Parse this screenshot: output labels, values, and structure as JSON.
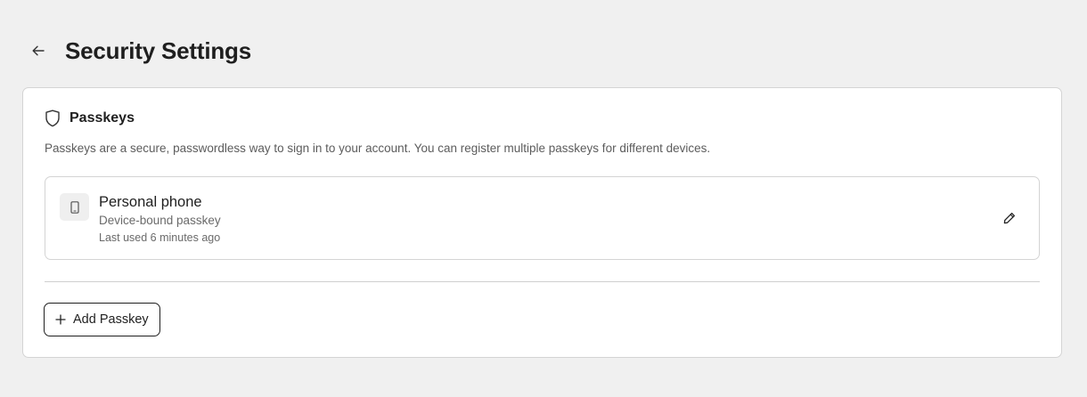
{
  "header": {
    "back_icon": "arrow-left-icon",
    "title": "Security Settings"
  },
  "passkeys": {
    "icon": "shield-icon",
    "title": "Passkeys",
    "description": "Passkeys are a secure, passwordless way to sign in to your account. You can register multiple passkeys for different devices.",
    "items": [
      {
        "icon": "smartphone-icon",
        "name": "Personal phone",
        "type": "Device-bound passkey",
        "last_used": "Last used 6 minutes ago",
        "edit_icon": "pencil-icon"
      }
    ],
    "add_button": {
      "icon": "plus-icon",
      "label": "Add Passkey"
    }
  },
  "colors": {
    "background": "#f0f0f0",
    "card": "#ffffff",
    "border": "#d4d4d4",
    "text_primary": "#1f1f1f",
    "text_secondary": "#5c5c5c"
  }
}
